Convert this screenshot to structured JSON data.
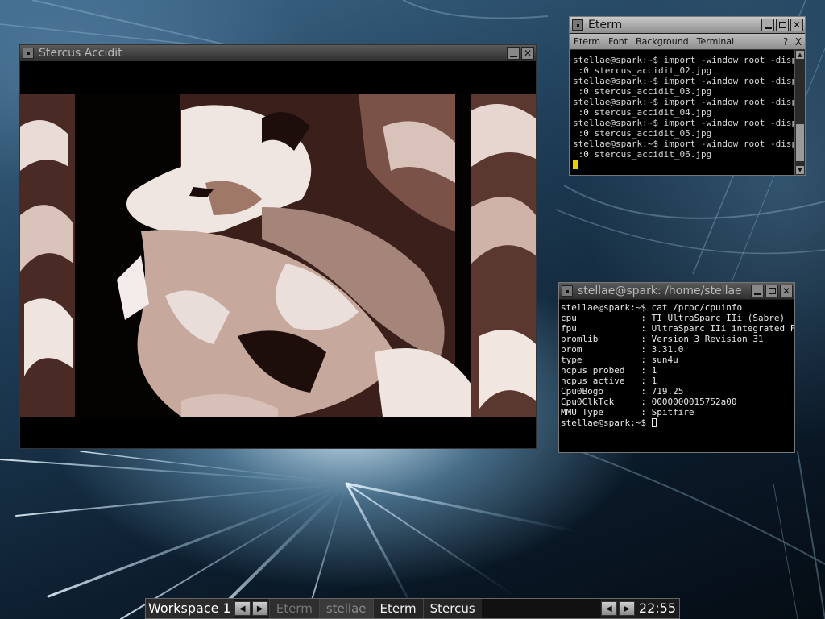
{
  "desktop": {},
  "viewer": {
    "title": "Stercus Accidit"
  },
  "eterm": {
    "title": "Eterm",
    "menu": [
      "Eterm",
      "Font",
      "Background",
      "Terminal"
    ],
    "help_label": "?",
    "close_label": "X",
    "lines": [
      "stellae@spark:~$ import -window root -display",
      " :0 stercus_accidit_02.jpg",
      "stellae@spark:~$ import -window root -display",
      " :0 stercus_accidit_03.jpg",
      "stellae@spark:~$ import -window root -display",
      " :0 stercus_accidit_04.jpg",
      "stellae@spark:~$ import -window root -display",
      " :0 stercus_accidit_05.jpg",
      "stellae@spark:~$ import -window root -display",
      " :0 stercus_accidit_06.jpg"
    ]
  },
  "xterm": {
    "title": "stellae@spark: /home/stellae",
    "command_line": "stellae@spark:~$ cat /proc/cpuinfo",
    "rows": [
      {
        "key": "cpu",
        "value": "TI UltraSparc IIi (Sabre)"
      },
      {
        "key": "fpu",
        "value": "UltraSparc IIi integrated FPU"
      },
      {
        "key": "promlib",
        "value": "Version 3 Revision 31"
      },
      {
        "key": "prom",
        "value": "3.31.0"
      },
      {
        "key": "type",
        "value": "sun4u"
      },
      {
        "key": "ncpus probed",
        "value": "1"
      },
      {
        "key": "ncpus active",
        "value": "1"
      },
      {
        "key": "Cpu0Bogo",
        "value": "719.25"
      },
      {
        "key": "Cpu0ClkTck",
        "value": "0000000015752a00"
      },
      {
        "key": "MMU Type",
        "value": "Spitfire"
      }
    ],
    "prompt": "stellae@spark:~$ "
  },
  "taskbar": {
    "workspace": "Workspace 1",
    "tasks": [
      "Eterm",
      "stellae",
      "Eterm",
      "Stercus"
    ],
    "clock": "22:55"
  },
  "icons": [
    "window-menu-icon",
    "minimize-icon",
    "maximize-icon",
    "close-icon",
    "arrow-left-icon",
    "arrow-right-icon",
    "scroll-up-icon",
    "scroll-down-icon"
  ]
}
